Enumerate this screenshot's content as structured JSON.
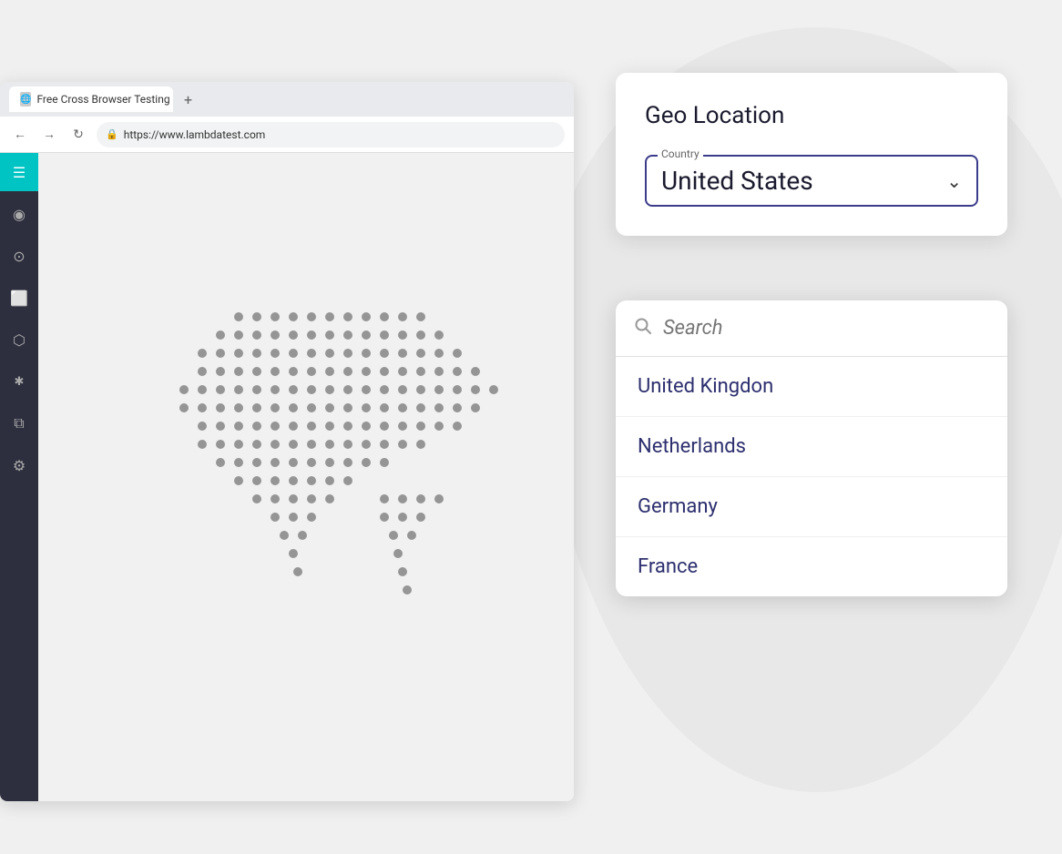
{
  "browser": {
    "tab_title": "Free Cross Browser Testing Clou...",
    "url": "https://www.lambdatest.com",
    "favicon": "🌐"
  },
  "sidebar": {
    "items": [
      {
        "name": "menu",
        "icon": "☰",
        "active": true
      },
      {
        "name": "globe",
        "icon": "◎"
      },
      {
        "name": "clock",
        "icon": "⊙"
      },
      {
        "name": "screenshot",
        "icon": "⬜"
      },
      {
        "name": "box",
        "icon": "⬡"
      },
      {
        "name": "bug",
        "icon": "🐞"
      },
      {
        "name": "layers",
        "icon": "⧉"
      },
      {
        "name": "settings",
        "icon": "⚙"
      }
    ]
  },
  "geo_card": {
    "title": "Geo Location",
    "country_label": "Country",
    "selected_country": "United States",
    "chevron": "∨"
  },
  "dropdown": {
    "search_placeholder": "Search",
    "countries": [
      "United Kingdon",
      "Netherlands",
      "Germany",
      "France"
    ]
  }
}
